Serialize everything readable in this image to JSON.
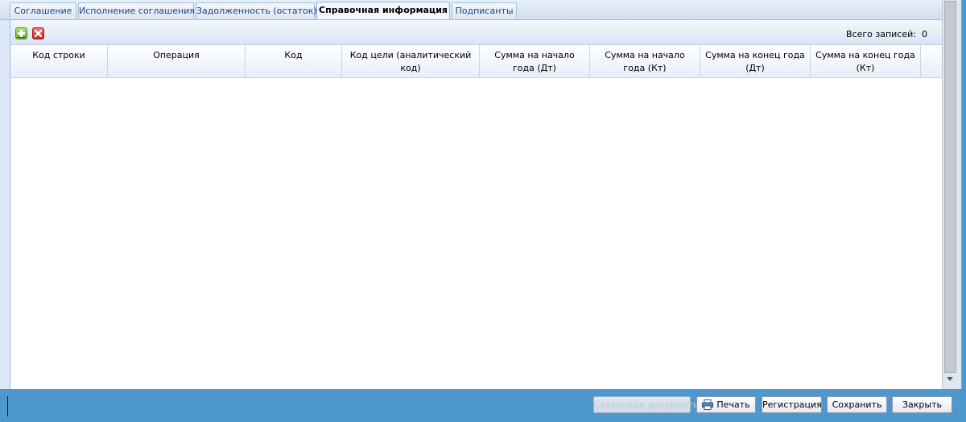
{
  "tabs": [
    {
      "label": "Соглашение",
      "active": false
    },
    {
      "label": "Исполнение соглашения",
      "active": false
    },
    {
      "label": "Задолженность (остаток)",
      "active": false
    },
    {
      "label": "Справочная информация",
      "active": true
    },
    {
      "label": "Подписанты",
      "active": false
    }
  ],
  "toolbar": {
    "add_icon": "add-row-icon",
    "delete_icon": "delete-row-icon",
    "records_label": "Всего записей:",
    "records_count": "0"
  },
  "grid": {
    "columns": [
      "Код строки",
      "Операция",
      "Код",
      "Код цели (аналитический код)",
      "Сумма на начало года (Дт)",
      "Сумма на начало года (Кт)",
      "Сумма на конец года (Дт)",
      "Сумма на конец года (Кт)"
    ],
    "rows": []
  },
  "footer": {
    "linked_docs_label": "Связанные документы",
    "print_label": "Печать",
    "print_icon": "printer-icon",
    "register_label": "Регистрация",
    "save_label": "Сохранить",
    "close_label": "Закрыть"
  },
  "colors": {
    "accent": "#4f97cf",
    "tab_text": "#15428b",
    "add_green": "#5fa823",
    "delete_red": "#d21f16"
  }
}
